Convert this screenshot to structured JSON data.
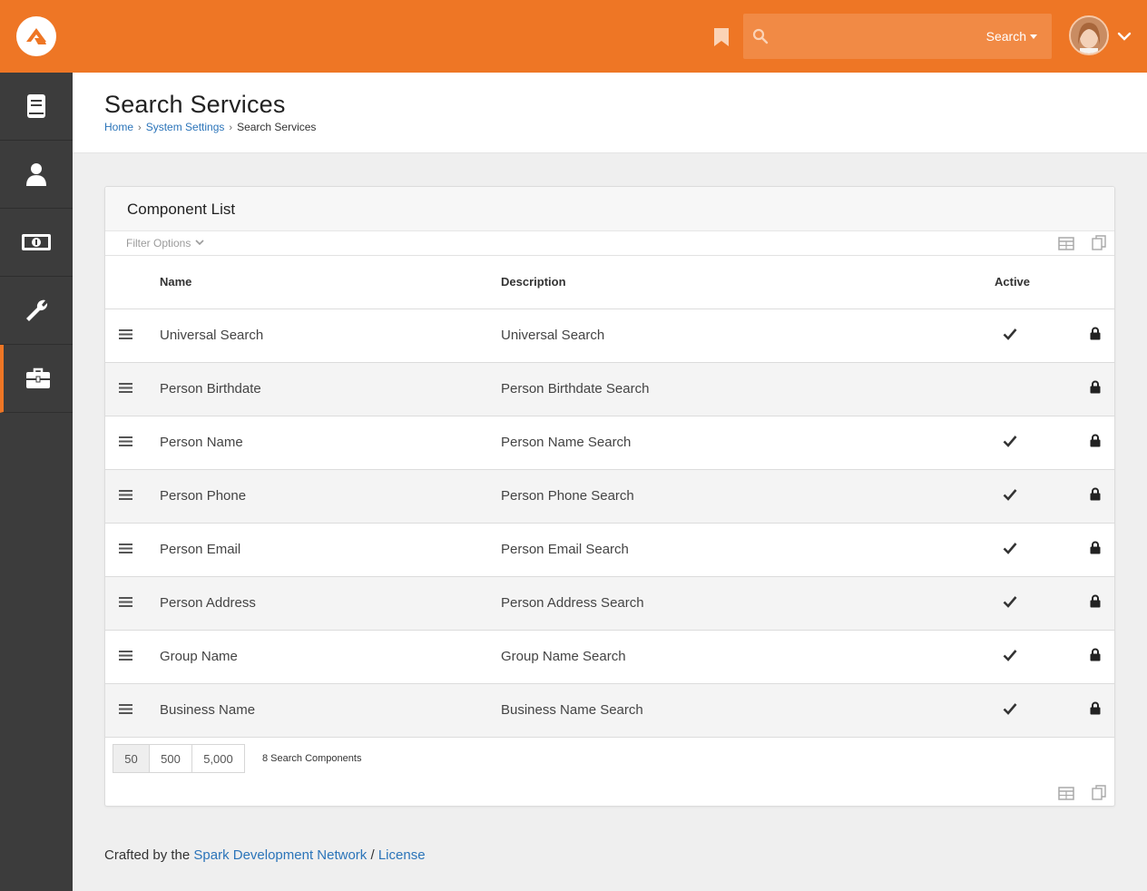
{
  "topbar": {
    "search_type_label": "Search",
    "colors": {
      "brand": "#ee7625"
    }
  },
  "sidebar": {
    "items": [
      {
        "icon": "book-icon"
      },
      {
        "icon": "person-icon"
      },
      {
        "icon": "money-icon"
      },
      {
        "icon": "wrench-icon"
      },
      {
        "icon": "briefcase-icon",
        "active": true
      }
    ]
  },
  "page": {
    "title": "Search Services",
    "breadcrumb": [
      "Home",
      "System Settings",
      "Search Services"
    ]
  },
  "panel": {
    "title": "Component List",
    "filter_label": "Filter Options",
    "columns": [
      "Name",
      "Description",
      "Active"
    ],
    "rows": [
      {
        "name": "Universal Search",
        "description": "Universal Search",
        "active": true
      },
      {
        "name": "Person Birthdate",
        "description": "Person Birthdate Search",
        "active": false
      },
      {
        "name": "Person Name",
        "description": "Person Name Search",
        "active": true
      },
      {
        "name": "Person Phone",
        "description": "Person Phone Search",
        "active": true
      },
      {
        "name": "Person Email",
        "description": "Person Email Search",
        "active": true
      },
      {
        "name": "Person Address",
        "description": "Person Address Search",
        "active": true
      },
      {
        "name": "Group Name",
        "description": "Group Name Search",
        "active": true
      },
      {
        "name": "Business Name",
        "description": "Business Name Search",
        "active": true
      }
    ],
    "page_sizes": [
      "50",
      "500",
      "5,000"
    ],
    "selected_page_size": "50",
    "count_label": "8 Search Components"
  },
  "footer": {
    "prefix": "Crafted by the",
    "link1": "Spark Development Network",
    "separator": "/",
    "link2": "License"
  }
}
